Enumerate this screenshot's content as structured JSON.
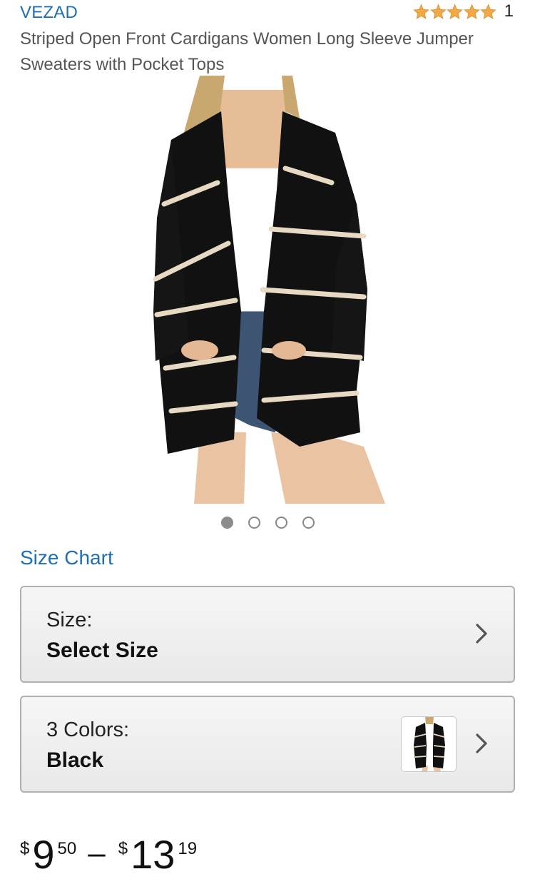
{
  "brand": "VEZAD",
  "rating": {
    "stars": 5,
    "count": "1",
    "star_color": "#f3a847"
  },
  "title": "Striped Open Front Cardigans Women Long Sleeve Jumper Sweaters with Pocket Tops",
  "image_carousel": {
    "count": 4,
    "active_index": 0
  },
  "size_chart_link": "Size Chart",
  "size_selector": {
    "label": "Size:",
    "value": "Select Size"
  },
  "color_selector": {
    "label": "3 Colors:",
    "value": "Black"
  },
  "price": {
    "low": {
      "currency": "$",
      "whole": "9",
      "fraction": "50"
    },
    "separator": "–",
    "high": {
      "currency": "$",
      "whole": "13",
      "fraction": "19"
    }
  },
  "icons": {
    "star": "star-icon",
    "chevron": "chevron-right-icon"
  },
  "colors": {
    "link": "#1f6fb2",
    "text": "#333333",
    "selector_bg": "#efefef"
  }
}
